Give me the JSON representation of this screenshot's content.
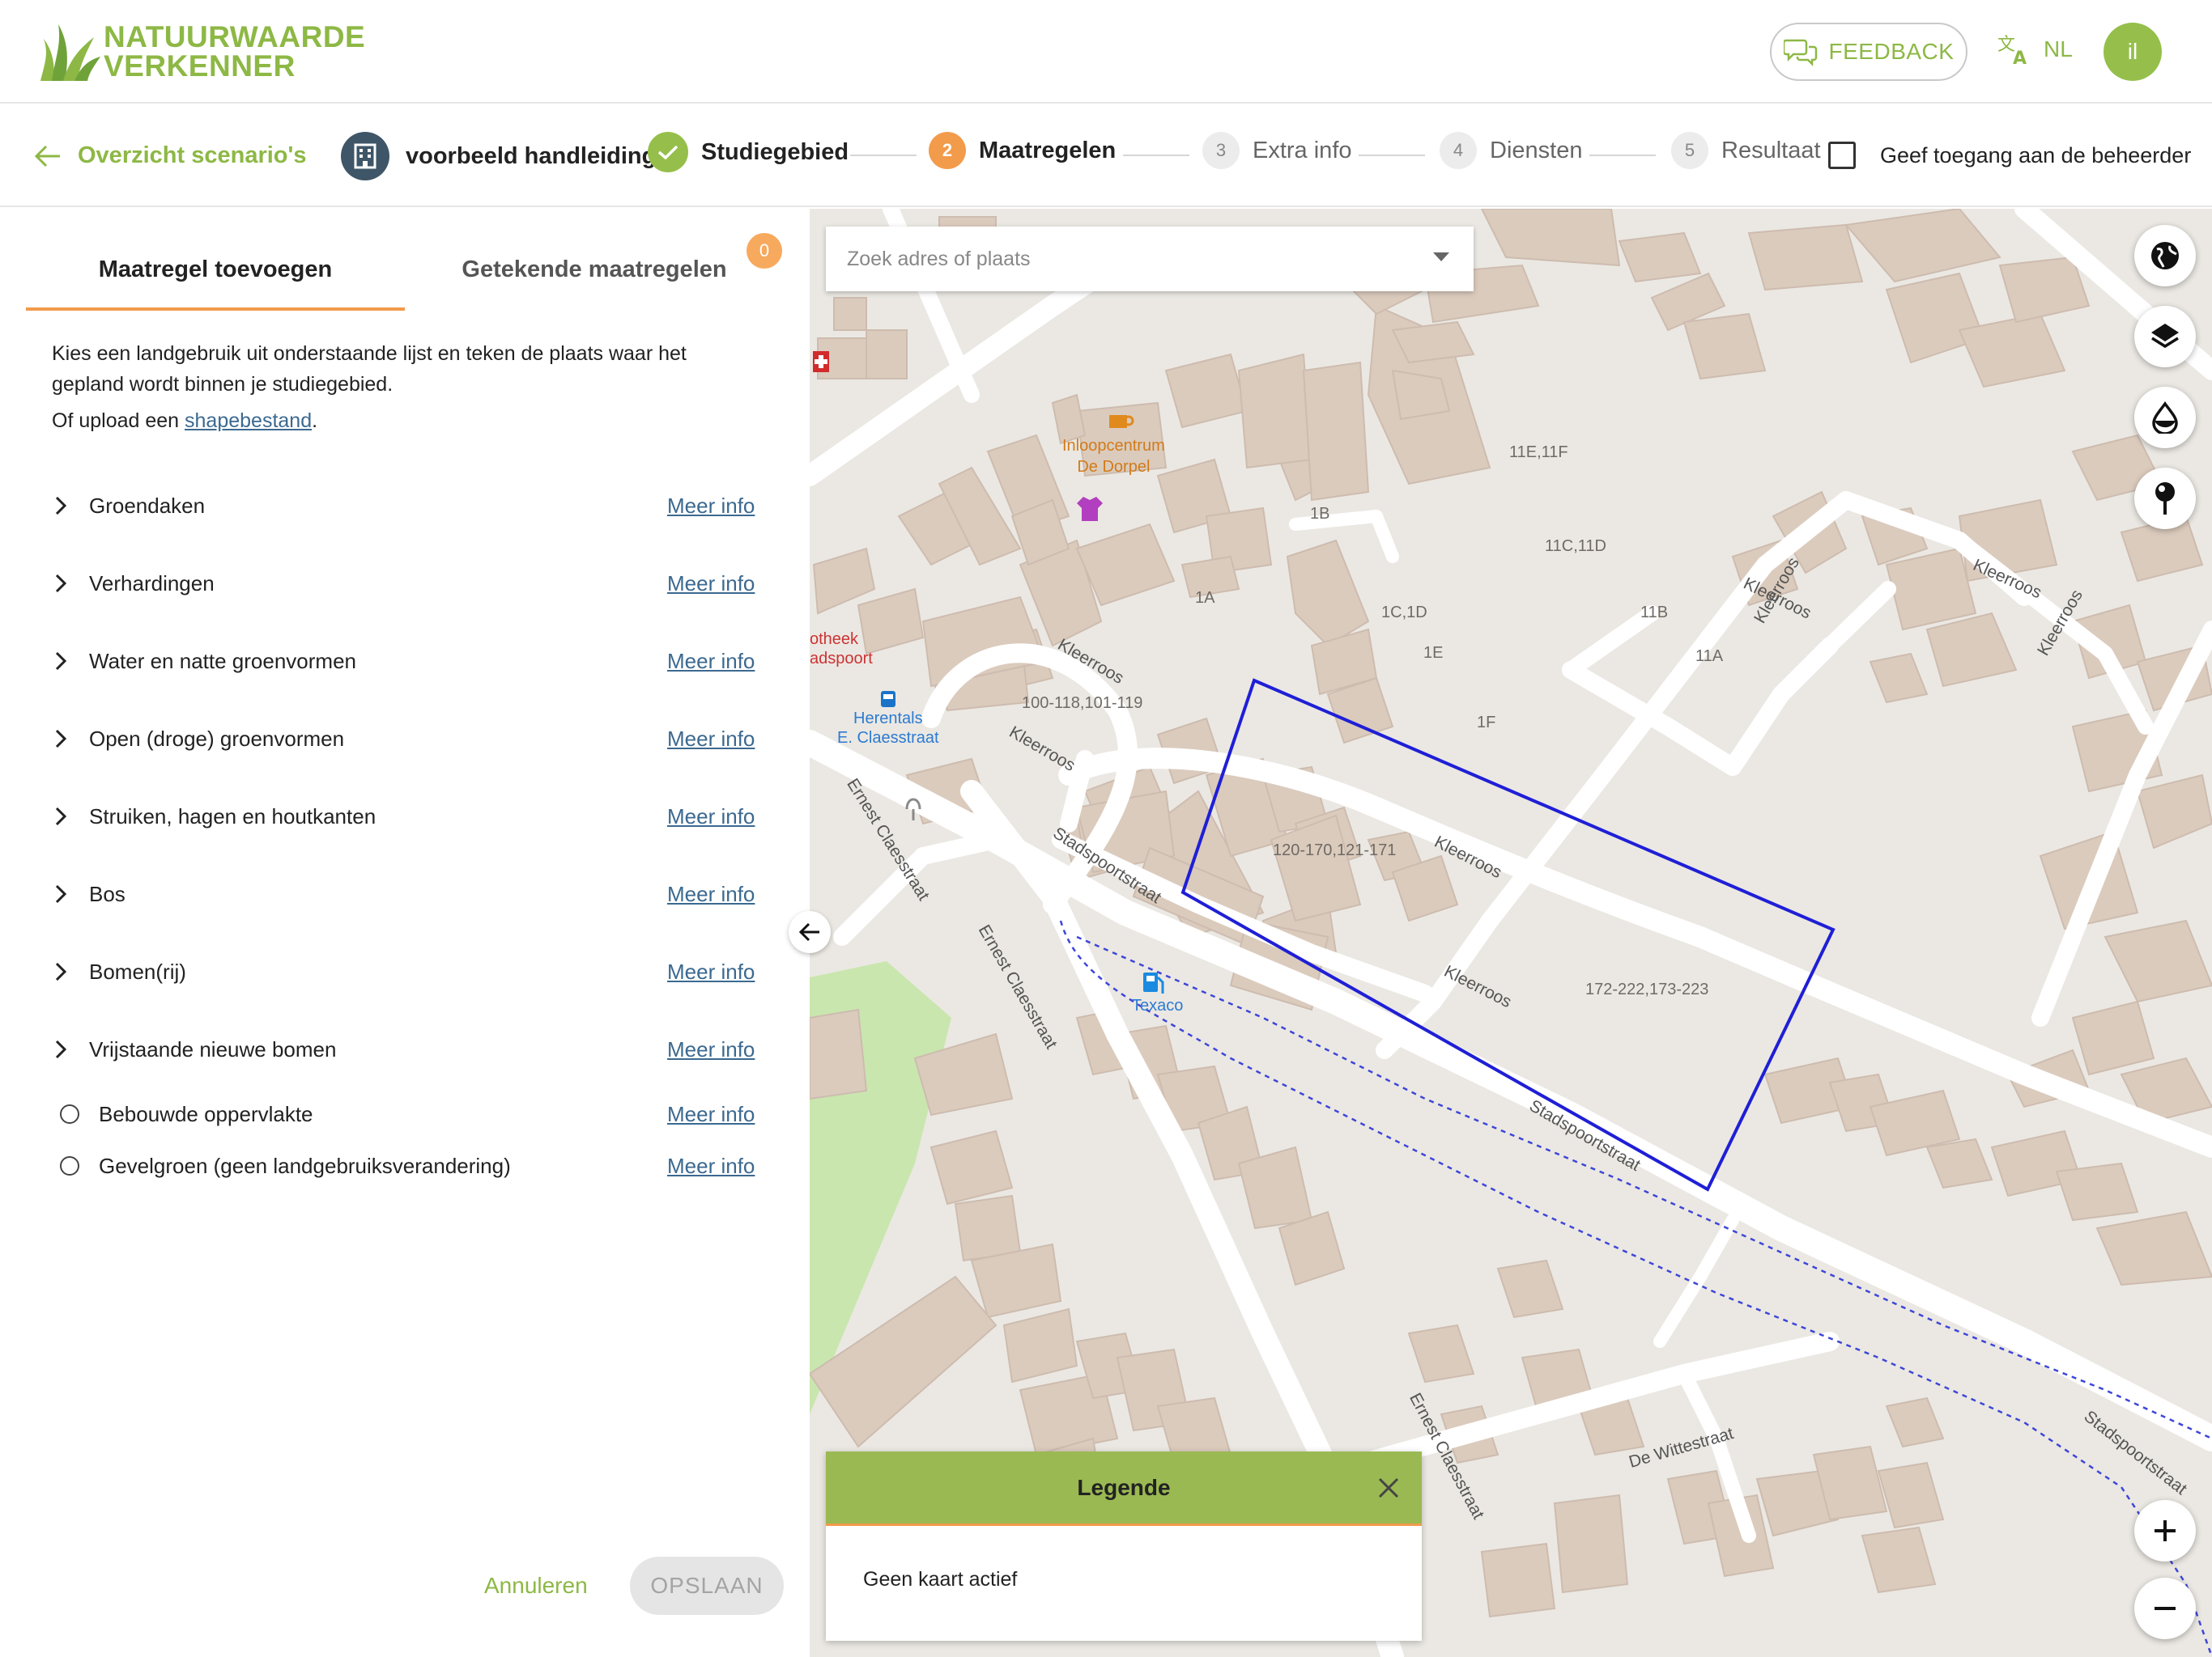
{
  "header": {
    "logo_line1": "NATUURWAARDE",
    "logo_line2": "VERKENNER",
    "feedback_label": "FEEDBACK",
    "language": "NL",
    "avatar_initials": "il",
    "brand_color": "#8db845"
  },
  "stepbar": {
    "back_label": "Overzicht scenario's",
    "scenario_name": "voorbeeld handleiding",
    "steps": [
      {
        "number": "",
        "label": "Studiegebied",
        "state": "done"
      },
      {
        "number": "2",
        "label": "Maatregelen",
        "state": "active"
      },
      {
        "number": "3",
        "label": "Extra info",
        "state": "todo"
      },
      {
        "number": "4",
        "label": "Diensten",
        "state": "todo"
      },
      {
        "number": "5",
        "label": "Resultaat",
        "state": "todo"
      }
    ],
    "access_label": "Geef toegang aan de beheerder",
    "access_checked": false
  },
  "panel": {
    "tabs": [
      {
        "label": "Maatregel toevoegen",
        "active": true
      },
      {
        "label": "Getekende maatregelen",
        "active": false
      }
    ],
    "drawn_count": "0",
    "intro": "Kies een landgebruik uit onderstaande lijst en teken de plaats waar het gepland wordt binnen je studiegebied.",
    "upload_prefix": "Of upload een ",
    "upload_link": "shapebestand",
    "upload_suffix": ".",
    "more_label": "Meer info",
    "categories": [
      {
        "label": "Groendaken",
        "type": "expand"
      },
      {
        "label": "Verhardingen",
        "type": "expand"
      },
      {
        "label": "Water en natte groenvormen",
        "type": "expand"
      },
      {
        "label": "Open (droge) groenvormen",
        "type": "expand"
      },
      {
        "label": "Struiken, hagen en houtkanten",
        "type": "expand"
      },
      {
        "label": "Bos",
        "type": "expand"
      },
      {
        "label": "Bomen(rij)",
        "type": "expand"
      },
      {
        "label": "Vrijstaande nieuwe bomen",
        "type": "expand"
      },
      {
        "label": "Bebouwde oppervlakte",
        "type": "radio"
      },
      {
        "label": "Gevelgroen (geen landgebruiksverandering)",
        "type": "radio"
      }
    ],
    "cancel_label": "Annuleren",
    "save_label": "OPSLAAN"
  },
  "map": {
    "search_placeholder": "Zoek adres of plaats",
    "legend_title": "Legende",
    "legend_text": "Geen kaart actief",
    "labels": {
      "inloop1": "Inloopcentrum",
      "inloop2": "De Dorpel",
      "apotheek1": "otheek",
      "apotheek2": "adspoort",
      "bus1": "Herentals",
      "bus2": "E. Claesstraat",
      "texaco": "Texaco",
      "kleerroos": "Kleerroos",
      "stadspoortstraat": "Stadspoortstraat",
      "ernest": "Ernest Claesstraat",
      "wittestraat": "De Wittestraat",
      "b_120": "120-170,121-171",
      "b_172": "172-222,173-223",
      "b_100": "100-118,101-119",
      "b_11e": "11E,11F",
      "b_11c": "11C,11D",
      "b_1c": "1C,1D",
      "b_1e": "1E",
      "b_1b": "1B",
      "b_1a": "1A",
      "b_11b": "11B",
      "b_11a": "11A",
      "b_1f": "1F"
    }
  }
}
